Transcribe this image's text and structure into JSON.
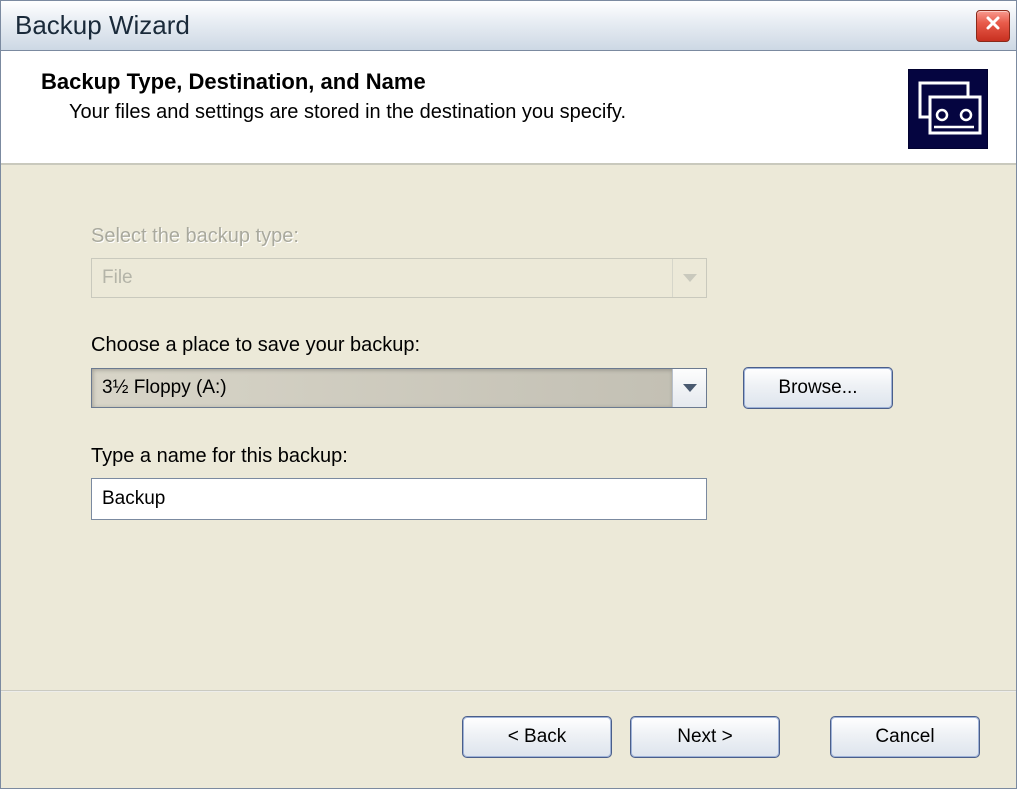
{
  "titlebar": {
    "title": "Backup Wizard"
  },
  "header": {
    "heading": "Backup Type, Destination, and Name",
    "subheading": "Your files and settings are stored in the destination you specify."
  },
  "form": {
    "backup_type_label": "Select the backup type:",
    "backup_type_value": "File",
    "location_label": "Choose a place to save your backup:",
    "location_value": "3½ Floppy (A:)",
    "browse_label": "Browse...",
    "name_label": "Type a name for this backup:",
    "name_value": "Backup"
  },
  "footer": {
    "back": "< Back",
    "next": "Next >",
    "cancel": "Cancel"
  }
}
